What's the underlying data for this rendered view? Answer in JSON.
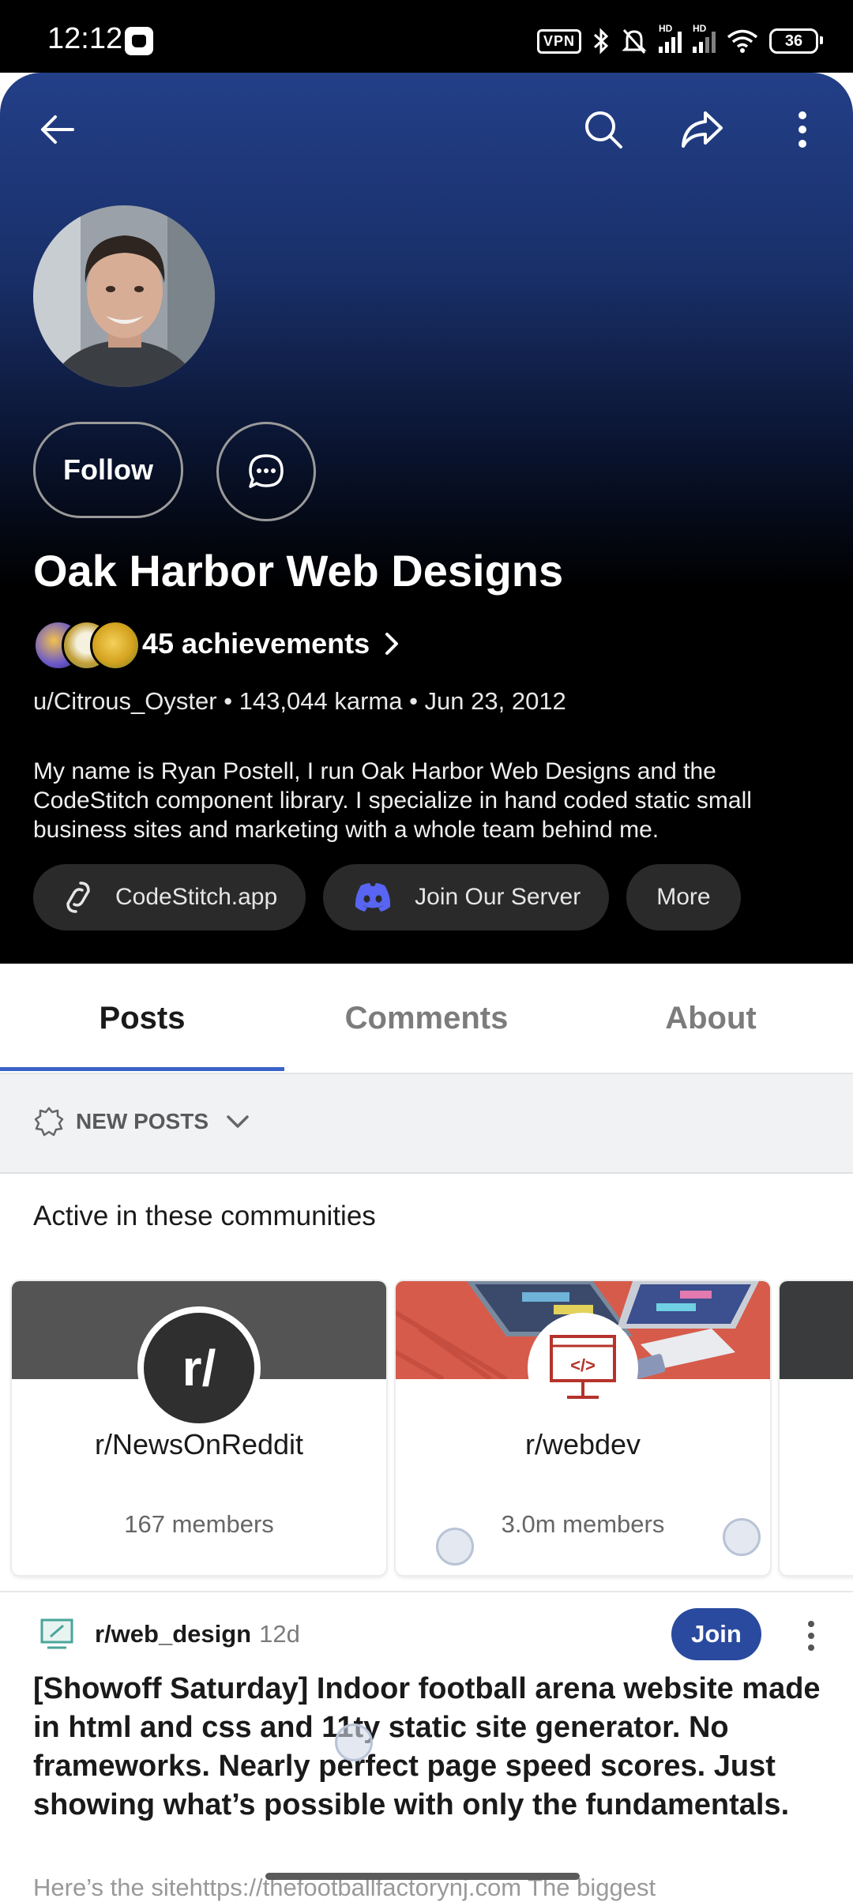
{
  "status_bar": {
    "time": "12:12",
    "vpn": "VPN",
    "hd1": "HD",
    "hd2": "HD",
    "battery": "36"
  },
  "profile": {
    "follow_label": "Follow",
    "display_name": "Oak Harbor Web Designs",
    "achievements_label": "45 achievements",
    "meta": "u/Citrous_Oyster • 143,044 karma • Jun 23, 2012",
    "bio": "My name is Ryan Postell, I run Oak Harbor Web Designs and the CodeStitch component library. I specialize in hand coded static small business sites and marketing with a whole team behind me.",
    "links": [
      {
        "label": "CodeStitch.app",
        "icon": "link-icon"
      },
      {
        "label": "Join Our Server",
        "icon": "discord-icon"
      },
      {
        "label": "More"
      }
    ]
  },
  "tabs": [
    {
      "label": "Posts",
      "active": true
    },
    {
      "label": "Comments",
      "active": false
    },
    {
      "label": "About",
      "active": false
    }
  ],
  "sort": {
    "label": "NEW POSTS"
  },
  "communities": {
    "title": "Active in these communities",
    "items": [
      {
        "name": "r/NewsOnReddit",
        "members": "167 members",
        "logo_text": "r/"
      },
      {
        "name": "r/webdev",
        "members": "3.0m members",
        "logo_text": "</>"
      }
    ]
  },
  "post": {
    "subreddit": "r/web_design",
    "age": "12d",
    "join_label": "Join",
    "title": "[Showoff Saturday] Indoor football arena website made in html and css and 11ty static site generator. No frameworks. Nearly perfect page speed scores. Just showing what’s possible with only the fundamentals.",
    "body_preview": "Here’s the sitehttps://thefootballfactorynj.com The biggest"
  },
  "colors": {
    "accent": "#3a63c7",
    "join": "#2a4a9f",
    "header_top": "#233f88"
  }
}
